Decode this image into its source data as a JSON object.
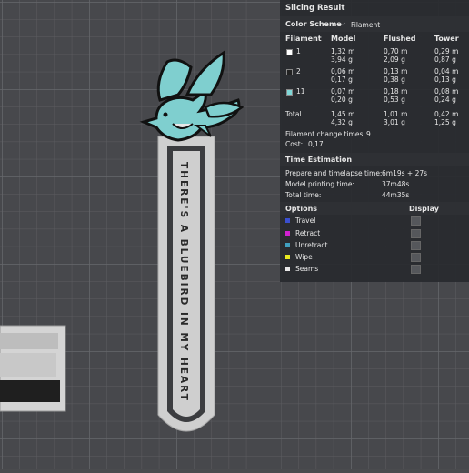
{
  "panel": {
    "title": "Slicing Result",
    "color_scheme_label": "Color Scheme",
    "color_scheme_value": "Filament",
    "headers": [
      "Filament",
      "Model",
      "Flushed",
      "Tower"
    ],
    "filaments": [
      {
        "id": "1",
        "color": "#ffffff",
        "model": [
          "1,32 m",
          "3,94 g"
        ],
        "flushed": [
          "0,70 m",
          "2,09 g"
        ],
        "tower": [
          "0,29 m",
          "0,87 g"
        ]
      },
      {
        "id": "2",
        "color": "#222222",
        "model": [
          "0,06 m",
          "0,17 g"
        ],
        "flushed": [
          "0,13 m",
          "0,38 g"
        ],
        "tower": [
          "0,04 m",
          "0,13 g"
        ]
      },
      {
        "id": "11",
        "color": "#7fd8d8",
        "model": [
          "0,07 m",
          "0,20 g"
        ],
        "flushed": [
          "0,18 m",
          "0,53 g"
        ],
        "tower": [
          "0,08 m",
          "0,24 g"
        ]
      }
    ],
    "total": {
      "label": "Total",
      "model": [
        "1,45 m",
        "4,32 g"
      ],
      "flushed": [
        "1,01 m",
        "3,01 g"
      ],
      "tower": [
        "0,42 m",
        "1,25 g"
      ]
    },
    "filament_change_label": "Filament change times:",
    "filament_change_value": "9",
    "cost_label": "Cost:",
    "cost_value": "0,17",
    "time_title": "Time Estimation",
    "times": [
      {
        "label": "Prepare and timelapse time:",
        "value": "6m19s + 27s"
      },
      {
        "label": "Model printing time:",
        "value": "37m48s"
      },
      {
        "label": "Total time:",
        "value": "44m35s"
      }
    ],
    "options_title": "Options",
    "display_title": "Display",
    "options": [
      {
        "label": "Travel",
        "color": "#3a4fd0"
      },
      {
        "label": "Retract",
        "color": "#d020d0"
      },
      {
        "label": "Unretract",
        "color": "#40a0c0"
      },
      {
        "label": "Wipe",
        "color": "#e8e820"
      },
      {
        "label": "Seams",
        "color": "#e8e8e8"
      }
    ]
  },
  "model": {
    "text": "THERE'S A BLUEBIRD IN MY HEART",
    "bird_color": "#7fcfcf",
    "bookmark_color": "#cfcfcf"
  }
}
